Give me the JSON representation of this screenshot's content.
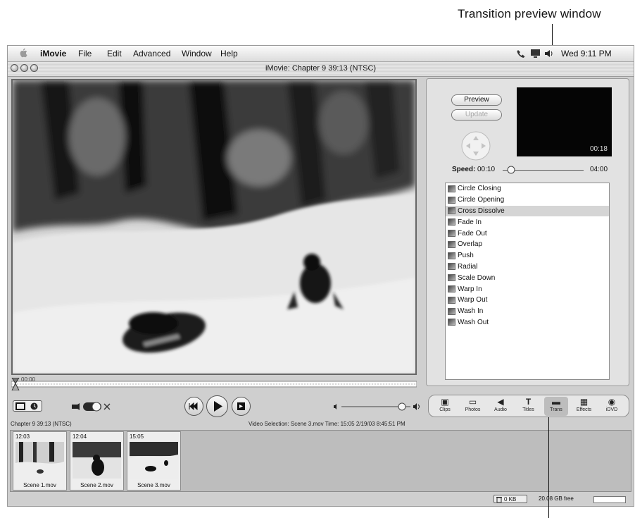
{
  "callouts": {
    "top": "Transition preview window"
  },
  "menubar": {
    "app": "iMovie",
    "items": [
      "File",
      "Edit",
      "Advanced",
      "Window",
      "Help"
    ],
    "clock": "Wed 9:11 PM"
  },
  "window": {
    "title": "iMovie: Chapter 9  39:13 (NTSC)"
  },
  "monitor": {
    "playhead_time": "00:00"
  },
  "transitions": {
    "preview_button": "Preview",
    "update_button": "Update",
    "preview_time": "00:18",
    "speed_label": "Speed:",
    "speed_value": "00:10",
    "speed_max": "04:00",
    "speed_fraction": 0.05,
    "list": [
      "Circle Closing",
      "Circle Opening",
      "Cross Dissolve",
      "Fade In",
      "Fade Out",
      "Overlap",
      "Push",
      "Radial",
      "Scale Down",
      "Warp In",
      "Warp Out",
      "Wash In",
      "Wash Out"
    ],
    "selected": "Cross Dissolve"
  },
  "pane_buttons": [
    {
      "label": "Clips",
      "icon": "clips-icon"
    },
    {
      "label": "Photos",
      "icon": "photos-icon"
    },
    {
      "label": "Audio",
      "icon": "audio-icon"
    },
    {
      "label": "Titles",
      "icon": "titles-icon"
    },
    {
      "label": "Trans",
      "icon": "trans-icon"
    },
    {
      "label": "Effects",
      "icon": "effects-icon"
    },
    {
      "label": "iDVD",
      "icon": "idvd-icon"
    }
  ],
  "selected_pane": "Trans",
  "info": {
    "left": "Chapter 9  39:13 (NTSC)",
    "center": "Video Selection: Scene 3.mov Time: 15:05 2/19/03 8:45:51 PM"
  },
  "clips": [
    {
      "time": "12:03",
      "name": "Scene 1.mov"
    },
    {
      "time": "12:04",
      "name": "Scene 2.mov"
    },
    {
      "time": "15:05",
      "name": "Scene 3.mov"
    }
  ],
  "status": {
    "trash": "0 KB",
    "free": "20.08 GB free"
  }
}
